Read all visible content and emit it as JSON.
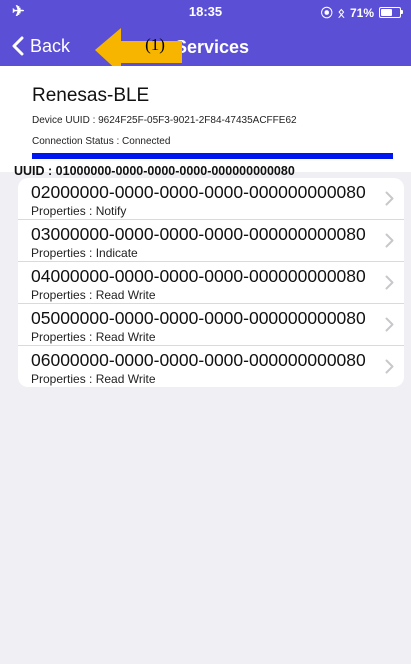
{
  "status_bar": {
    "time": "18:35",
    "battery_text": "71%",
    "battery_level": 0.71
  },
  "nav": {
    "back_label": "Back",
    "title": "Services"
  },
  "annotation": {
    "label": "(1)",
    "color": "#f7b500"
  },
  "device": {
    "name": "Renesas-BLE",
    "uuid_text": "Device UUID :  9624F25F-05F3-9021-2F84-47435ACFFE62",
    "connection_text": "Connection Status :   Connected",
    "progress": 1.0
  },
  "service": {
    "uuid_text": "UUID : 01000000-0000-0000-0000-000000000080"
  },
  "characteristics": [
    {
      "uuid": "02000000-0000-0000-0000-000000000080",
      "properties": "Properties : Notify"
    },
    {
      "uuid": "03000000-0000-0000-0000-000000000080",
      "properties": "Properties : Indicate"
    },
    {
      "uuid": "04000000-0000-0000-0000-000000000080",
      "properties": "Properties : Read  Write"
    },
    {
      "uuid": "05000000-0000-0000-0000-000000000080",
      "properties": "Properties : Read  Write"
    },
    {
      "uuid": "06000000-0000-0000-0000-000000000080",
      "properties": "Properties : Read  Write"
    }
  ],
  "colors": {
    "nav_bar": "#5b4fd6",
    "progress": "#0016ee",
    "background": "#efeff4"
  }
}
